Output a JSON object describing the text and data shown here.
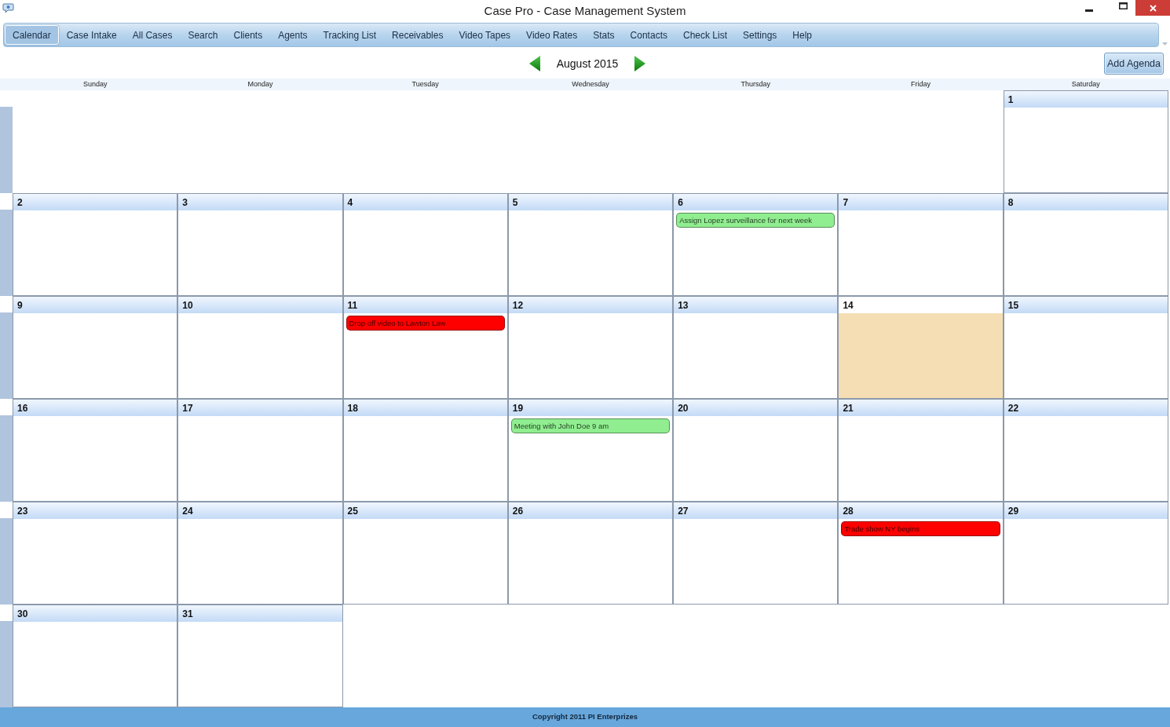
{
  "window": {
    "title": "Case Pro - Case Management System"
  },
  "menu": [
    {
      "label": "Calendar",
      "selected": true
    },
    {
      "label": "Case Intake",
      "selected": false
    },
    {
      "label": "All Cases",
      "selected": false
    },
    {
      "label": "Search",
      "selected": false
    },
    {
      "label": "Clients",
      "selected": false
    },
    {
      "label": "Agents",
      "selected": false
    },
    {
      "label": "Tracking List",
      "selected": false
    },
    {
      "label": "Receivables",
      "selected": false
    },
    {
      "label": "Video Tapes",
      "selected": false
    },
    {
      "label": "Video Rates",
      "selected": false
    },
    {
      "label": "Stats",
      "selected": false
    },
    {
      "label": "Contacts",
      "selected": false
    },
    {
      "label": "Check List",
      "selected": false
    },
    {
      "label": "Settings",
      "selected": false
    },
    {
      "label": "Help",
      "selected": false
    }
  ],
  "calendar": {
    "month": "August 2015",
    "add_button": "Add Agenda",
    "weekdays": [
      "Sunday",
      "Monday",
      "Tuesday",
      "Wednesday",
      "Thursday",
      "Friday",
      "Saturday"
    ],
    "weeks": [
      {
        "days": [
          {
            "day": "1",
            "today": false
          }
        ]
      },
      {
        "days": [
          {
            "day": "2",
            "today": false
          },
          {
            "day": "3",
            "today": false
          },
          {
            "day": "4",
            "today": false
          },
          {
            "day": "5",
            "today": false
          },
          {
            "day": "6",
            "today": false,
            "events": [
              {
                "text": "Assign Lopez surveillance for next week",
                "color": "#90ee90"
              }
            ]
          },
          {
            "day": "7",
            "today": false
          },
          {
            "day": "8",
            "today": false
          }
        ]
      },
      {
        "days": [
          {
            "day": "9",
            "today": false
          },
          {
            "day": "10",
            "today": false
          },
          {
            "day": "11",
            "today": false,
            "events": [
              {
                "text": "Drop off video to Lawton Law",
                "color": "#ff0000"
              }
            ]
          },
          {
            "day": "12",
            "today": false
          },
          {
            "day": "13",
            "today": false
          },
          {
            "day": "14",
            "today": true
          },
          {
            "day": "15",
            "today": false
          }
        ]
      },
      {
        "days": [
          {
            "day": "16",
            "today": false
          },
          {
            "day": "17",
            "today": false
          },
          {
            "day": "18",
            "today": false
          },
          {
            "day": "19",
            "today": false,
            "events": [
              {
                "text": "Meeting with John Doe 9 am",
                "color": "#90ee90"
              }
            ]
          },
          {
            "day": "20",
            "today": false
          },
          {
            "day": "21",
            "today": false
          },
          {
            "day": "22",
            "today": false
          }
        ]
      },
      {
        "days": [
          {
            "day": "23",
            "today": false
          },
          {
            "day": "24",
            "today": false
          },
          {
            "day": "25",
            "today": false
          },
          {
            "day": "26",
            "today": false
          },
          {
            "day": "27",
            "today": false
          },
          {
            "day": "28",
            "today": false,
            "events": [
              {
                "text": "Trade show NY begins",
                "color": "#ff0000"
              }
            ]
          },
          {
            "day": "29",
            "today": false
          }
        ]
      },
      {
        "days": [
          {
            "day": "30",
            "today": false
          },
          {
            "day": "31",
            "today": false
          }
        ]
      }
    ]
  },
  "status_bar": {
    "text": "Copyright 2011 PI Enterprizes"
  }
}
